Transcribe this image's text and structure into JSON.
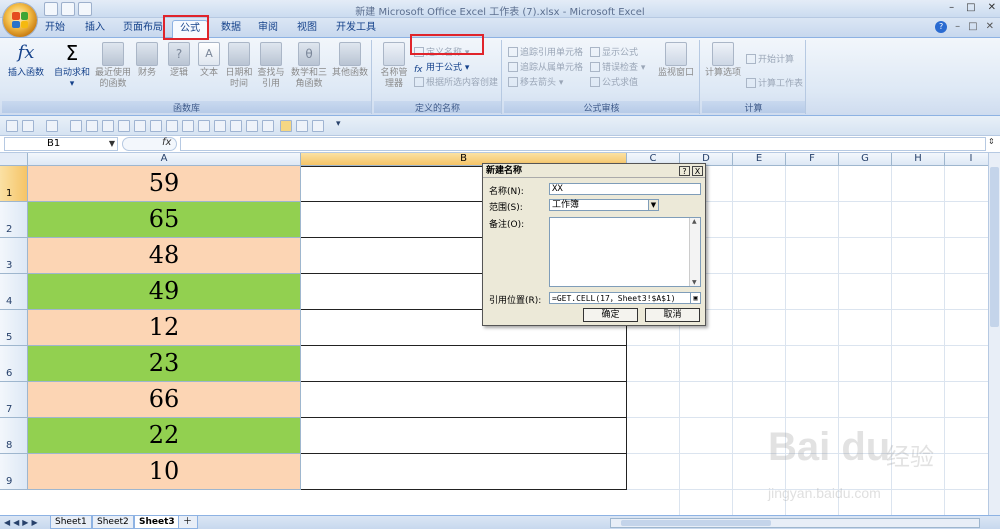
{
  "window": {
    "title": "新建 Microsoft Office Excel 工作表 (7).xlsx - Microsoft Excel",
    "controls": [
      "–",
      "□",
      "✕"
    ]
  },
  "tabs": [
    {
      "label": "开始"
    },
    {
      "label": "插入"
    },
    {
      "label": "页面布局"
    },
    {
      "label": "公式",
      "active": true
    },
    {
      "label": "数据"
    },
    {
      "label": "审阅"
    },
    {
      "label": "视图"
    },
    {
      "label": "开发工具"
    }
  ],
  "ribbon": {
    "function_library": {
      "label": "函数库",
      "insert_function": "插入函数",
      "autosum": "自动求和",
      "recent": "最近使用的函数",
      "financial": "财务",
      "logical": "逻辑",
      "text": "文本",
      "datetime": "日期和时间",
      "lookup": "查找与引用",
      "math": "数学和三角函数",
      "other": "其他函数"
    },
    "defined_names": {
      "label": "定义的名称",
      "name_manager": "名称管理器",
      "define_name": "定义名称",
      "use_in_formula": "用于公式",
      "create_from_selection": "根据所选内容创建"
    },
    "formula_auditing": {
      "label": "公式审核",
      "trace_precedents": "追踪引用单元格",
      "trace_dependents": "追踪从属单元格",
      "remove_arrows": "移去箭头",
      "show_formulas": "显示公式",
      "error_checking": "错误检查",
      "evaluate_formula": "公式求值",
      "watch_window": "监视窗口"
    },
    "calculation": {
      "label": "计算",
      "calc_options": "计算选项",
      "calc_now": "开始计算",
      "calc_sheet": "计算工作表"
    }
  },
  "formula_bar": {
    "name_box": "B1",
    "fx": "fx",
    "value": ""
  },
  "sheet": {
    "columns": [
      "A",
      "B",
      "C",
      "D",
      "E",
      "F",
      "G",
      "H",
      "I"
    ],
    "rows": [
      "1",
      "2",
      "3",
      "4",
      "5",
      "6",
      "7",
      "8",
      "9"
    ],
    "values": [
      "59",
      "65",
      "48",
      "49",
      "12",
      "23",
      "66",
      "22",
      "10"
    ],
    "fills": [
      "#fcd5b4",
      "#92d050",
      "#fcd5b4",
      "#92d050",
      "#fcd5b4",
      "#92d050",
      "#fcd5b4",
      "#92d050",
      "#fcd5b4"
    ]
  },
  "sheet_tabs": [
    "Sheet1",
    "Sheet2",
    "Sheet3"
  ],
  "active_sheet": "Sheet3",
  "dialog": {
    "title": "新建名称",
    "help": "?",
    "close": "X",
    "name_label": "名称(N):",
    "name_value": "XX",
    "scope_label": "范围(S):",
    "scope_value": "工作簿",
    "comment_label": "备注(O):",
    "refers_to_label": "引用位置(R):",
    "refers_to_value": "=GET.CELL(17，Sheet3!$A$1)",
    "ok": "确定",
    "cancel": "取消"
  },
  "watermark": {
    "brand": "Bai du",
    "cn": "经验",
    "url": "jingyan.baidu.com"
  },
  "colors": {
    "peach": "#fcd5b4",
    "green": "#92d050",
    "highlight_red": "#e0242b",
    "ribbon_blue": "#15428b"
  }
}
